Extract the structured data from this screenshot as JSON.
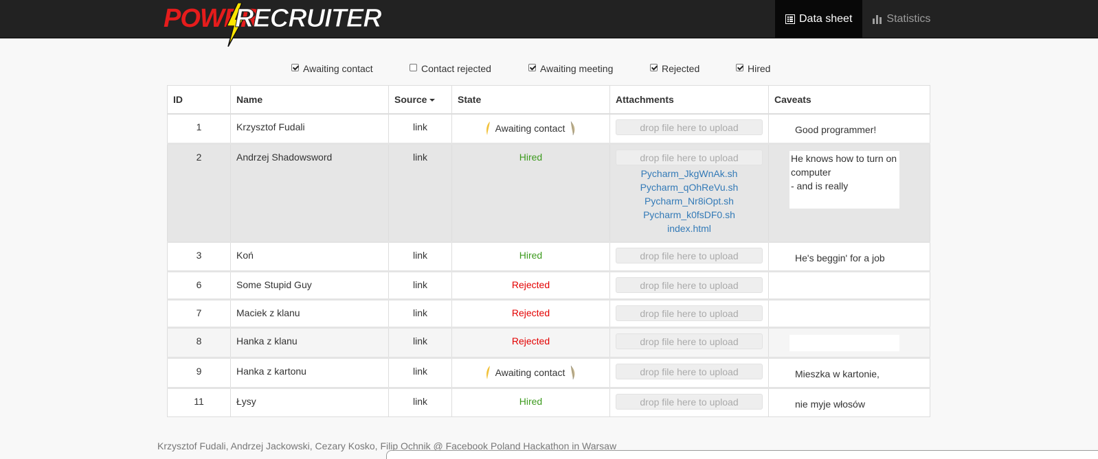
{
  "brand": {
    "part1": "POWER",
    "part2": "RECRUITER"
  },
  "nav": {
    "tabs": [
      {
        "label": "Data sheet",
        "icon": "list-alt-icon",
        "active": true
      },
      {
        "label": "Statistics",
        "icon": "stats-icon",
        "active": false
      }
    ]
  },
  "filters": [
    {
      "label": "Awaiting contact",
      "checked": true
    },
    {
      "label": "Contact rejected",
      "checked": false
    },
    {
      "label": "Awaiting meeting",
      "checked": true
    },
    {
      "label": "Rejected",
      "checked": true
    },
    {
      "label": "Hired",
      "checked": true
    }
  ],
  "table": {
    "columns": [
      "ID",
      "Name",
      "Source",
      "State",
      "Attachments",
      "Caveats"
    ],
    "drop_placeholder": "drop file here to upload",
    "rows": [
      {
        "id": "1",
        "name": "Krzysztof Fudali",
        "source": "link",
        "state": "Awaiting contact",
        "state_kind": "awaiting",
        "attachments": [],
        "caveat": "Good programmer!"
      },
      {
        "id": "2",
        "name": "Andrzej Shadowsword",
        "source": "link",
        "state": "Hired",
        "state_kind": "hired",
        "attachments": [
          "Pycharm_JkgWnAk.sh",
          "Pycharm_qOhReVu.sh",
          "Pycharm_Nr8iOpt.sh",
          "Pycharm_k0fsDF0.sh",
          "index.html"
        ],
        "caveat": "He knows how to turn on computer\n- and is really"
      },
      {
        "id": "3",
        "name": "Koń",
        "source": "link",
        "state": "Hired",
        "state_kind": "hired",
        "attachments": [],
        "caveat": "He's beggin' for a job"
      },
      {
        "id": "6",
        "name": "Some Stupid Guy",
        "source": "link",
        "state": "Rejected",
        "state_kind": "rejected",
        "attachments": [],
        "caveat": ""
      },
      {
        "id": "7",
        "name": "Maciek z klanu",
        "source": "link",
        "state": "Rejected",
        "state_kind": "rejected",
        "attachments": [],
        "caveat": ""
      },
      {
        "id": "8",
        "name": "Hanka z klanu",
        "source": "link",
        "state": "Rejected",
        "state_kind": "rejected",
        "attachments": [],
        "caveat": ""
      },
      {
        "id": "9",
        "name": "Hanka z kartonu",
        "source": "link",
        "state": "Awaiting contact",
        "state_kind": "awaiting",
        "attachments": [],
        "caveat": "Mieszka w kartonie,"
      },
      {
        "id": "11",
        "name": "Łysy",
        "source": "link",
        "state": "Hired",
        "state_kind": "hired",
        "attachments": [],
        "caveat": "nie myje włosów"
      }
    ]
  },
  "footer": {
    "text": "Krzysztof Fudali, Andrzej Jackowski, Cezary Kosko, Filip Ochnik @ Facebook Poland Hackathon in Warsaw"
  },
  "colors": {
    "navbar": "#222222",
    "brand_red": "#e51c1c",
    "bolt": "#ffe600",
    "hired": "#3c9a1d",
    "rejected": "#e30000",
    "link": "#337ab7"
  }
}
